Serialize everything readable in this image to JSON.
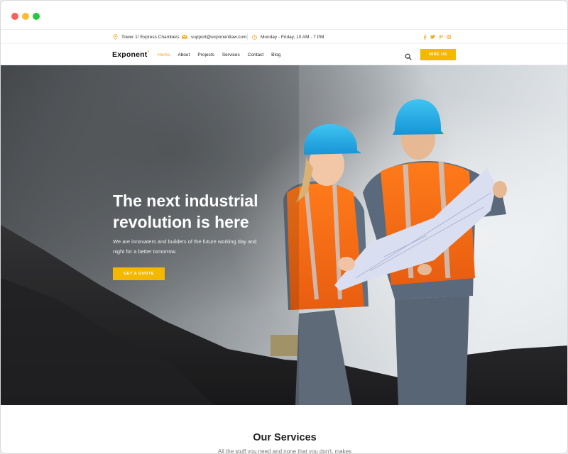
{
  "topbar": {
    "address": "Tower 1! Express Chambers",
    "email": "support@exponentlaw.com",
    "hours": "Monday - Friday, 10 AM - 7 PM",
    "socials": [
      "facebook-icon",
      "twitter-icon",
      "pinterest-icon",
      "instagram-icon"
    ],
    "accent": "#f5a623"
  },
  "navbar": {
    "logo": "Exponent",
    "logo_mark": "+",
    "items": [
      {
        "label": "Home",
        "active": true
      },
      {
        "label": "About"
      },
      {
        "label": "Projects"
      },
      {
        "label": "Services"
      },
      {
        "label": "Contact"
      },
      {
        "label": "Blog"
      }
    ],
    "cta": "HIRE US"
  },
  "hero": {
    "title_line1": "The next industrial",
    "title_line2": "revolution is here",
    "subtitle": "We are innovaters and builders of the future working day and night for a better tomorrow.",
    "cta": "GET A QUOTE",
    "cta_color": "#f5b800"
  },
  "services": {
    "heading": "Our Services",
    "subheading": "All the stuff you need and none that you don't, makes"
  }
}
